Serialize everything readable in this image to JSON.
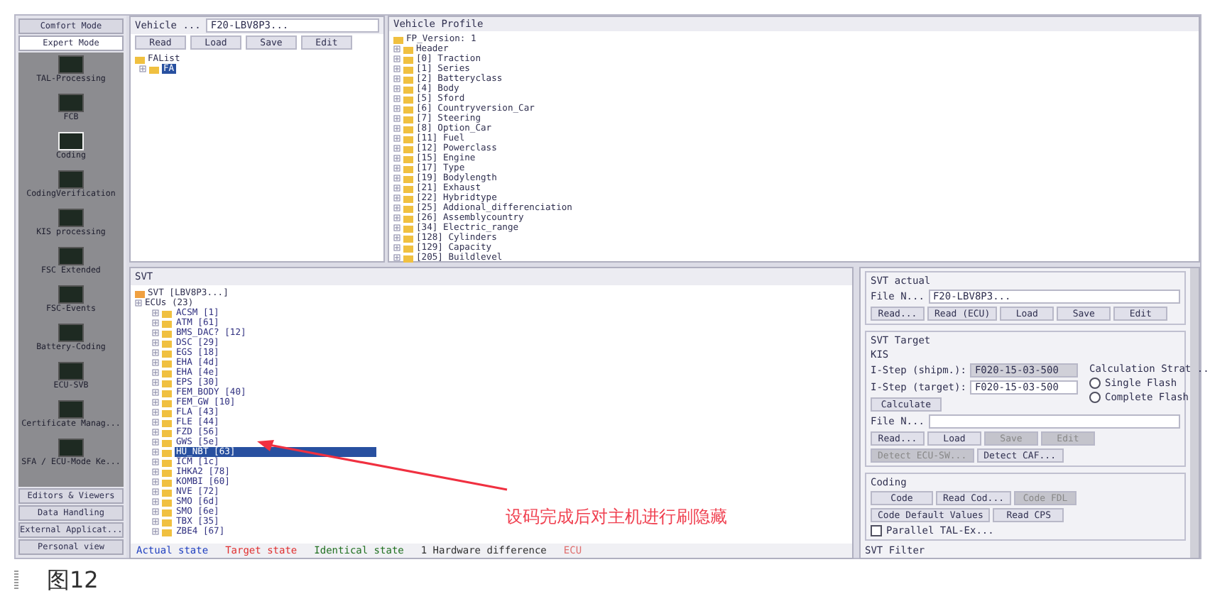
{
  "sidebar": {
    "modes": [
      {
        "label": "Comfort Mode",
        "selected": false
      },
      {
        "label": "Expert Mode",
        "selected": true
      }
    ],
    "items": [
      {
        "label": "TAL-Processing",
        "selected": false
      },
      {
        "label": "FCB",
        "selected": false
      },
      {
        "label": "Coding",
        "selected": true
      },
      {
        "label": "CodingVerification",
        "selected": false
      },
      {
        "label": "KIS processing",
        "selected": false
      },
      {
        "label": "FSC Extended",
        "selected": false
      },
      {
        "label": "FSC-Events",
        "selected": false
      },
      {
        "label": "Battery-Coding",
        "selected": false
      },
      {
        "label": "ECU-SVB",
        "selected": false
      },
      {
        "label": "Certificate Manag...",
        "selected": false
      },
      {
        "label": "SFA / ECU-Mode Ke...",
        "selected": false
      }
    ],
    "bottom": [
      "Editors & Viewers",
      "Data Handling",
      "External Applicat...",
      "Personal view"
    ]
  },
  "vehicle": {
    "title": "Vehicle ...",
    "value": "F20-LBV8P3...",
    "buttons": [
      "Read",
      "Load",
      "Save",
      "Edit"
    ],
    "tree": {
      "label": "FAList",
      "children": [
        {
          "label": "FA",
          "selected": true
        }
      ]
    }
  },
  "profile": {
    "title": "Vehicle Profile",
    "version": "FP_Version: 1",
    "header": "Header",
    "items": [
      "[0]  Traction",
      "[1]  Series",
      "[2]  Batteryclass",
      "[4]  Body",
      "[5]  Sford",
      "[6]  Countryversion_Car",
      "[7]  Steering",
      "[8]  Option_Car",
      "[11]  Fuel",
      "[12]  Powerclass",
      "[15]  Engine",
      "[17]  Type",
      "[19]  Bodylength",
      "[21]  Exhaust",
      "[22]  Hybridtype",
      "[25]  Addional_differenciation",
      "[26]  Assemblycountry",
      "[34]  Electric_range",
      "[128]  Cylinders",
      "[129]  Capacity",
      "[205]  Buildlevel"
    ]
  },
  "svt": {
    "title": "SVT",
    "root": "SVT  [LBV8P3...]",
    "ecus_label": "ECUs  (23)",
    "ecus": [
      {
        "label": "ACSM  [1]",
        "selected": false
      },
      {
        "label": "ATM  [61]",
        "selected": false
      },
      {
        "label": "BMS_DAC?  [12]",
        "selected": false
      },
      {
        "label": "DSC  [29]",
        "selected": false
      },
      {
        "label": "EGS  [18]",
        "selected": false
      },
      {
        "label": "EHA  [4d]",
        "selected": false
      },
      {
        "label": "EHA  [4e]",
        "selected": false
      },
      {
        "label": "EPS  [30]",
        "selected": false
      },
      {
        "label": "FEM_BODY  [40]",
        "selected": false
      },
      {
        "label": "FEM_GW  [10]",
        "selected": false
      },
      {
        "label": "FLA  [43]",
        "selected": false
      },
      {
        "label": "FLE  [44]",
        "selected": false
      },
      {
        "label": "FZD  [56]",
        "selected": false
      },
      {
        "label": "GWS  [5e]",
        "selected": false
      },
      {
        "label": "HU_NBT  [63]",
        "selected": true
      },
      {
        "label": "ICM  [1c]",
        "selected": false
      },
      {
        "label": "IHKA2  [78]",
        "selected": false
      },
      {
        "label": "KOMBI  [60]",
        "selected": false
      },
      {
        "label": "NVE  [72]",
        "selected": false
      },
      {
        "label": "SMO  [6d]",
        "selected": false
      },
      {
        "label": "SMO  [6e]",
        "selected": false
      },
      {
        "label": "TBX  [35]",
        "selected": false
      },
      {
        "label": "ZBE4  [67]",
        "selected": false
      }
    ],
    "legend": [
      {
        "label": "Actual state",
        "color": "#2040c0"
      },
      {
        "label": "Target state",
        "color": "#e03030"
      },
      {
        "label": "Identical state",
        "color": "#207020"
      },
      {
        "label": "1  Hardware difference",
        "color": "#303030"
      },
      {
        "label": "ECU",
        "color": "#e07070"
      }
    ]
  },
  "right": {
    "svt_actual": {
      "title": "SVT actual",
      "file_label": "File N...",
      "file_value": "F20-LBV8P3...",
      "buttons": [
        {
          "label": "Read...",
          "disabled": false
        },
        {
          "label": "Read (ECU)",
          "disabled": false
        },
        {
          "label": "Load",
          "disabled": false
        },
        {
          "label": "Save",
          "disabled": false
        },
        {
          "label": "Edit",
          "disabled": false
        }
      ]
    },
    "svt_target": {
      "title": "SVT Target",
      "kis_title": "KIS",
      "shipm_label": "I-Step (shipm.):",
      "shipm_value": "F020-15-03-500",
      "target_label": "I-Step (target):",
      "target_value": "F020-15-03-500",
      "calculate": "Calculate",
      "strategy_title": "Calculation Strat...",
      "strategies": [
        {
          "label": "Single Flash",
          "selected": false
        },
        {
          "label": "Complete Flash",
          "selected": false
        }
      ],
      "file_label": "File N...",
      "buttons": [
        {
          "label": "Read...",
          "disabled": false
        },
        {
          "label": "Load",
          "disabled": false
        },
        {
          "label": "Save",
          "disabled": true
        },
        {
          "label": "Edit",
          "disabled": true
        }
      ],
      "buttons2": [
        {
          "label": "Detect ECU-SW...",
          "disabled": true
        },
        {
          "label": "Detect CAF...",
          "disabled": false
        }
      ]
    },
    "coding": {
      "title": "Coding",
      "buttons": [
        {
          "label": "Code",
          "disabled": false
        },
        {
          "label": "Read Cod...",
          "disabled": false
        },
        {
          "label": "Code FDL",
          "disabled": true
        }
      ],
      "buttons2": [
        {
          "label": "Code Default Values",
          "disabled": false
        },
        {
          "label": "Read CPS",
          "disabled": false
        }
      ],
      "parallel": {
        "label": "Parallel TAL-Ex...",
        "checked": false
      }
    },
    "filter_title": "SVT Filter"
  },
  "annotation": "设码完成后对主机进行刷隐藏",
  "caption": "图12"
}
